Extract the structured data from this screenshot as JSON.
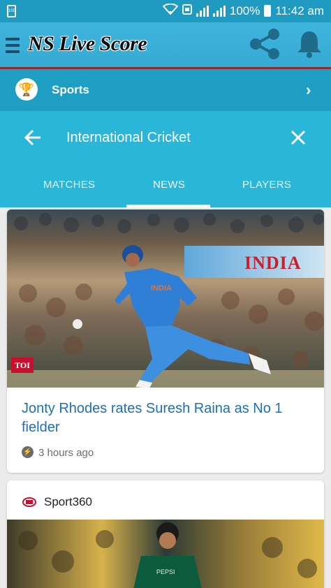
{
  "status_bar": {
    "sim_label": "100",
    "battery_percent": "100%",
    "time": "11:42 am"
  },
  "app_bar": {
    "title": "NS Live Score",
    "icons": [
      "menu-icon",
      "share-icon",
      "bell-icon"
    ]
  },
  "sports_row": {
    "label": "Sports",
    "icon": "trophy-icon"
  },
  "search_header": {
    "title": "International Cricket",
    "icons": [
      "back-arrow-icon",
      "close-icon"
    ]
  },
  "tabs": [
    {
      "label": "MATCHES",
      "active": false
    },
    {
      "label": "NEWS",
      "active": true
    },
    {
      "label": "PLAYERS",
      "active": false
    }
  ],
  "news": [
    {
      "image_badge": "TOI",
      "image_banner_text": "INDIA",
      "headline": "Jonty Rhodes rates Suresh Raina as No 1 fielder",
      "time": "3 hours ago"
    },
    {
      "source": "Sport360"
    }
  ],
  "colors": {
    "status_bar": "#1f9bc2",
    "app_bar": "#3fb4dc",
    "sports_row": "#1d9ec2",
    "search_header": "#29b6d8",
    "headline": "#1e6fb4",
    "accent_line": "#8f2b2b"
  }
}
